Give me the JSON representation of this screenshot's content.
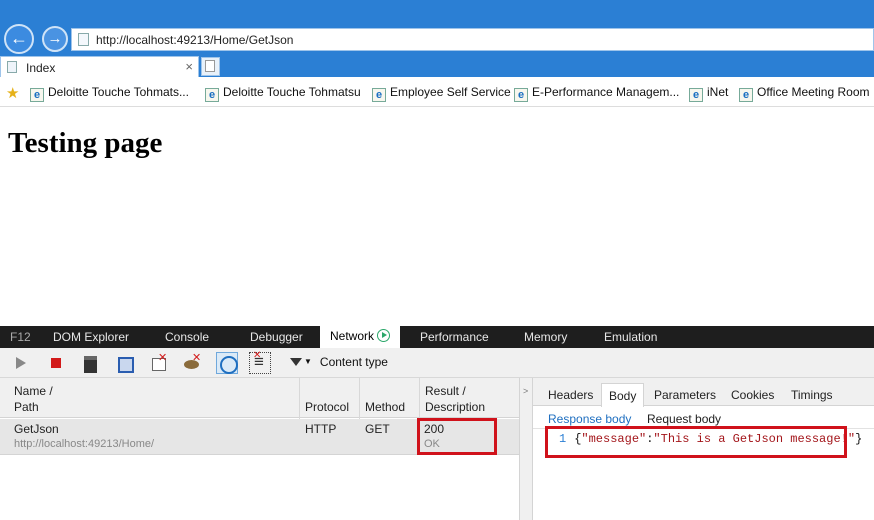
{
  "browser": {
    "url": "http://localhost:49213/Home/GetJson",
    "tab_title": "Index",
    "tab_close": "×",
    "favorites": [
      "Deloitte Touche Tohmats...",
      "Deloitte Touche Tohmatsu",
      "Employee Self Service",
      "E-Performance Managem...",
      "iNet",
      "Office Meeting Room"
    ]
  },
  "page": {
    "heading": "Testing page"
  },
  "devtools": {
    "tabs": [
      "F12",
      "DOM Explorer",
      "Console",
      "Debugger",
      "Network",
      "Performance",
      "Memory",
      "Emulation"
    ],
    "active_tab": "Network",
    "filter_label": "Content type",
    "columns": {
      "name_line1": "Name /",
      "name_line2": "Path",
      "protocol": "Protocol",
      "method": "Method",
      "result_line1": "Result /",
      "result_line2": "Description"
    },
    "request": {
      "name": "GetJson",
      "path": "http://localhost:49213/Home/",
      "protocol": "HTTP",
      "method": "GET",
      "status": "200",
      "description": "OK"
    },
    "detail_tabs": [
      "Headers",
      "Body",
      "Parameters",
      "Cookies",
      "Timings"
    ],
    "active_detail_tab": "Body",
    "body_subtabs": [
      "Response body",
      "Request body"
    ],
    "response": {
      "line_number": "1",
      "open": "{",
      "key": "\"message\"",
      "colon": ":",
      "value": "\"This is a GetJson message!\"",
      "close": "}"
    }
  },
  "colors": {
    "chrome_blue": "#2b7fd4",
    "highlight_red": "#d0121b",
    "devtools_dark": "#1e1e1e"
  }
}
